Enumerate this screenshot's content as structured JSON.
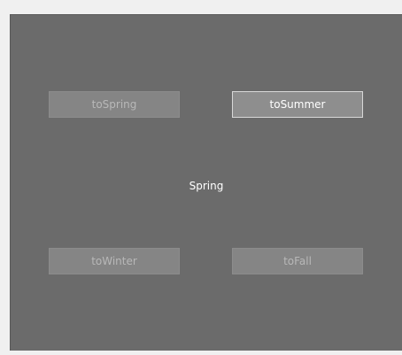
{
  "buttons": {
    "to_spring": {
      "label": "toSpring",
      "enabled": false
    },
    "to_summer": {
      "label": "toSummer",
      "enabled": true
    },
    "to_winter": {
      "label": "toWinter",
      "enabled": false
    },
    "to_fall": {
      "label": "toFall",
      "enabled": false
    }
  },
  "state": {
    "current": "Spring"
  },
  "colors": {
    "panel_bg": "#6b6b6b",
    "button_enabled_text": "#ffffff",
    "button_disabled_text": "#b8b8b8"
  }
}
